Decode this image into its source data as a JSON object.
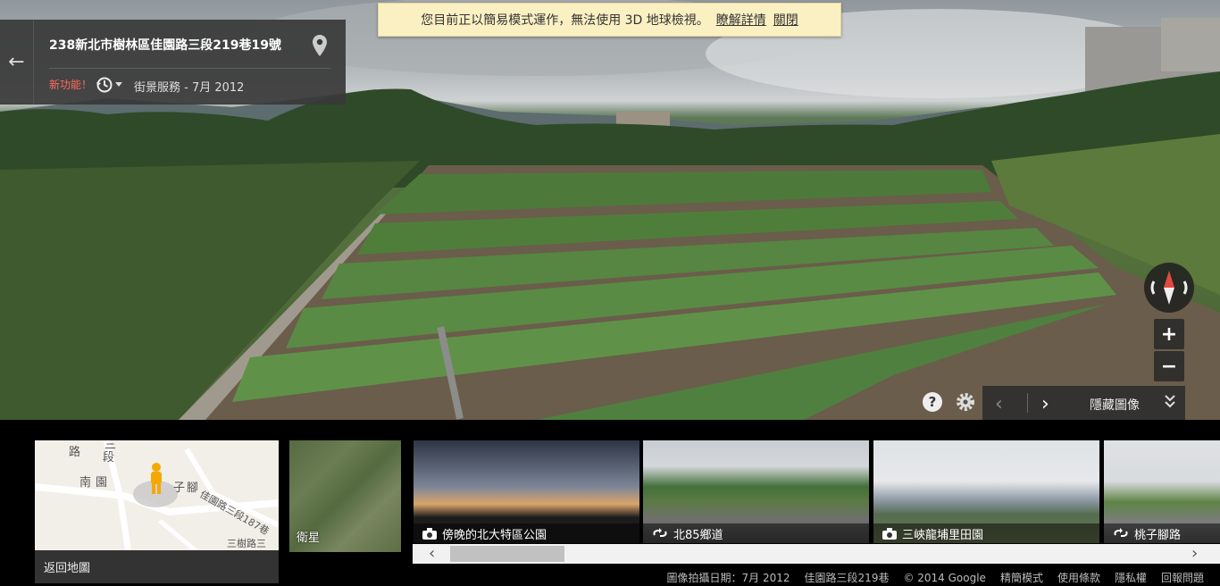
{
  "notice": {
    "text": "您目前正以簡易模式運作，無法使用 3D 地球檢視。",
    "learn_more": "瞭解詳情",
    "close": "關閉"
  },
  "card": {
    "address": "238新北市樹林區佳園路三段219巷19號",
    "new_feature": "新功能！",
    "service": "街景服務 - 7月 2012"
  },
  "controls": {
    "zoom_in": "+",
    "zoom_out": "−",
    "help": "?",
    "hide_images": "隱藏圖像",
    "prev": "‹",
    "next": "›"
  },
  "minimap": {
    "labels": [
      "路",
      "段",
      "三",
      "南",
      "園",
      "子",
      "腳",
      "佳園路三段187巷",
      "三樹路三"
    ],
    "footer": "返回地圖"
  },
  "satellite": {
    "label": "衛星"
  },
  "thumbnails": [
    {
      "caption": "傍晚的北大特區公園",
      "icon": "camera-icon"
    },
    {
      "caption": "北85鄉道",
      "icon": "street-view-icon"
    },
    {
      "caption": "三峽龍埔里田園",
      "icon": "camera-icon"
    },
    {
      "caption": "桃子腳路",
      "icon": "street-view-icon"
    }
  ],
  "scroll": {
    "left": "‹",
    "right": "›"
  },
  "footer": {
    "capture_date": "圖像拍攝日期：7月 2012",
    "street": "佳園路三段219巷",
    "copyright": "© 2014 Google",
    "lite_mode": "精簡模式",
    "terms": "使用條款",
    "privacy": "隱私權",
    "report": "回報問題"
  },
  "colors": {
    "accent_red": "#ff6b5e",
    "banner": "#fbf0c2",
    "card_bg": "#383838"
  }
}
